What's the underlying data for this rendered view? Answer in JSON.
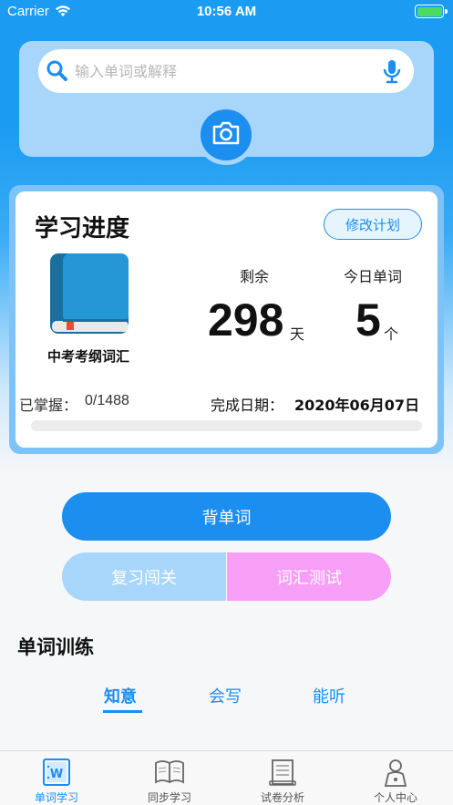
{
  "status_bar": {
    "carrier": "Carrier",
    "time": "10:56 AM",
    "battery_level": 1.0
  },
  "search": {
    "placeholder": "输入单词或解释",
    "value": ""
  },
  "progress": {
    "title": "学习进度",
    "modify_plan_label": "修改计划",
    "book_name": "中考考纲词汇",
    "remaining_label": "剩余",
    "remaining_value": "298",
    "remaining_unit": "天",
    "today_label": "今日单词",
    "today_value": "5",
    "today_unit": "个",
    "mastered_label": "已掌握：",
    "mastered_value": "0/1488",
    "finish_label": "完成日期：",
    "finish_value": "2020年06月07日",
    "progress_fraction": 0
  },
  "actions": {
    "memorize_label": "背单词",
    "review_label": "复习闯关",
    "test_label": "词汇测试"
  },
  "training": {
    "title": "单词训练",
    "tabs": [
      "知意",
      "会写",
      "能听"
    ],
    "selected_tab": "知意"
  },
  "nav": {
    "items": [
      {
        "label": "单词学习",
        "icon": "word-book-icon",
        "active": true
      },
      {
        "label": "同步学习",
        "icon": "open-book-icon",
        "active": false
      },
      {
        "label": "试卷分析",
        "icon": "paper-icon",
        "active": false
      },
      {
        "label": "个人中心",
        "icon": "person-icon",
        "active": false
      }
    ]
  },
  "colors": {
    "primary": "#1b8ef0",
    "review_button": "#a8d6fa",
    "test_button": "#f79ef6",
    "header": "#1b9cf2"
  }
}
